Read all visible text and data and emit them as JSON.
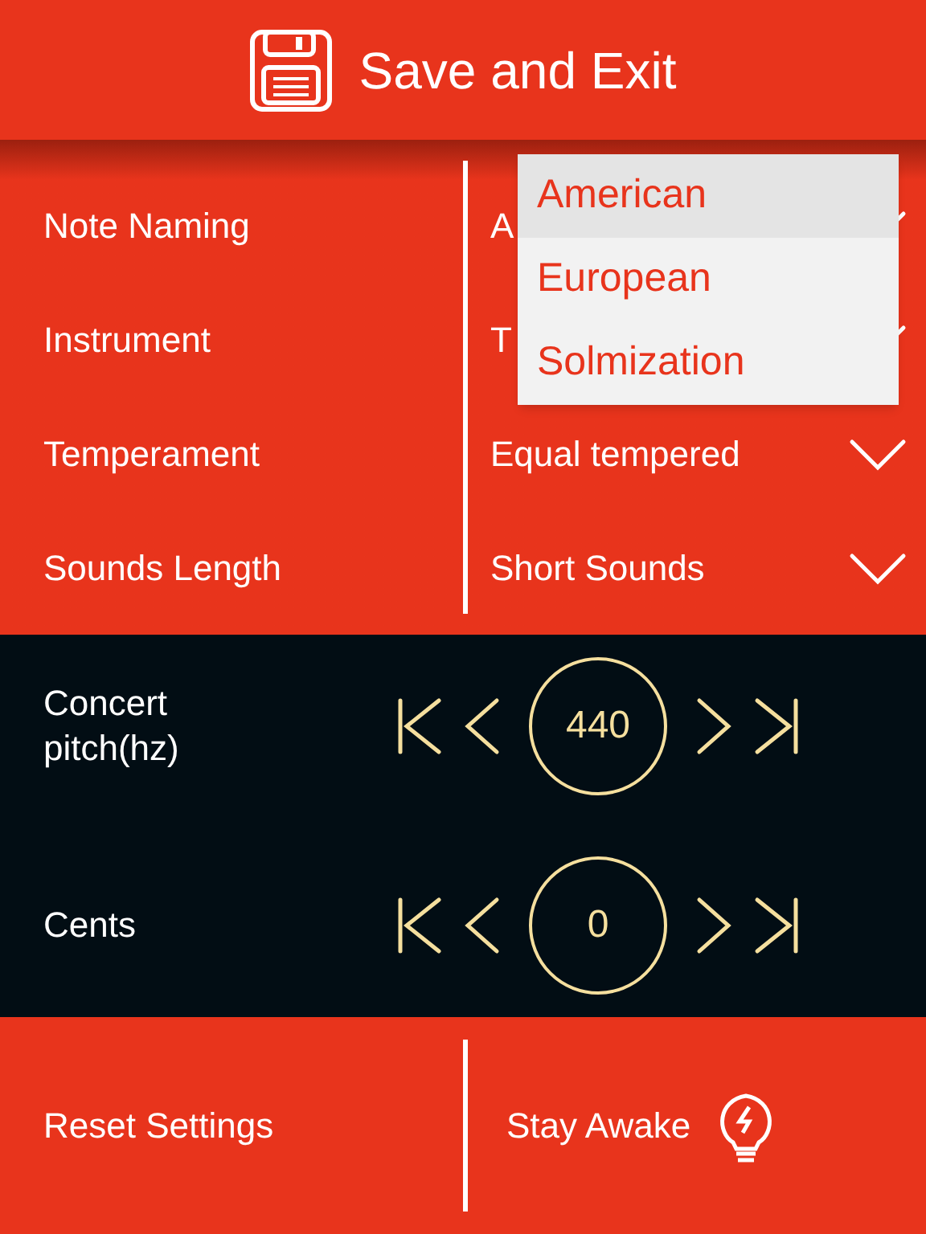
{
  "header": {
    "title": "Save and Exit"
  },
  "settings": [
    {
      "label": "Note Naming",
      "value": "A"
    },
    {
      "label": "Instrument",
      "value": "T"
    },
    {
      "label": "Temperament",
      "value": "Equal tempered"
    },
    {
      "label": "Sounds Length",
      "value": "Short Sounds"
    }
  ],
  "dropdown": {
    "options": [
      {
        "label": "American",
        "selected": true
      },
      {
        "label": "European",
        "selected": false
      },
      {
        "label": "Solmization",
        "selected": false
      }
    ]
  },
  "steppers": [
    {
      "label": "Concert pitch(hz)",
      "value": "440"
    },
    {
      "label": "Cents",
      "value": "0"
    }
  ],
  "footer": {
    "reset": "Reset Settings",
    "awake": "Stay Awake"
  }
}
